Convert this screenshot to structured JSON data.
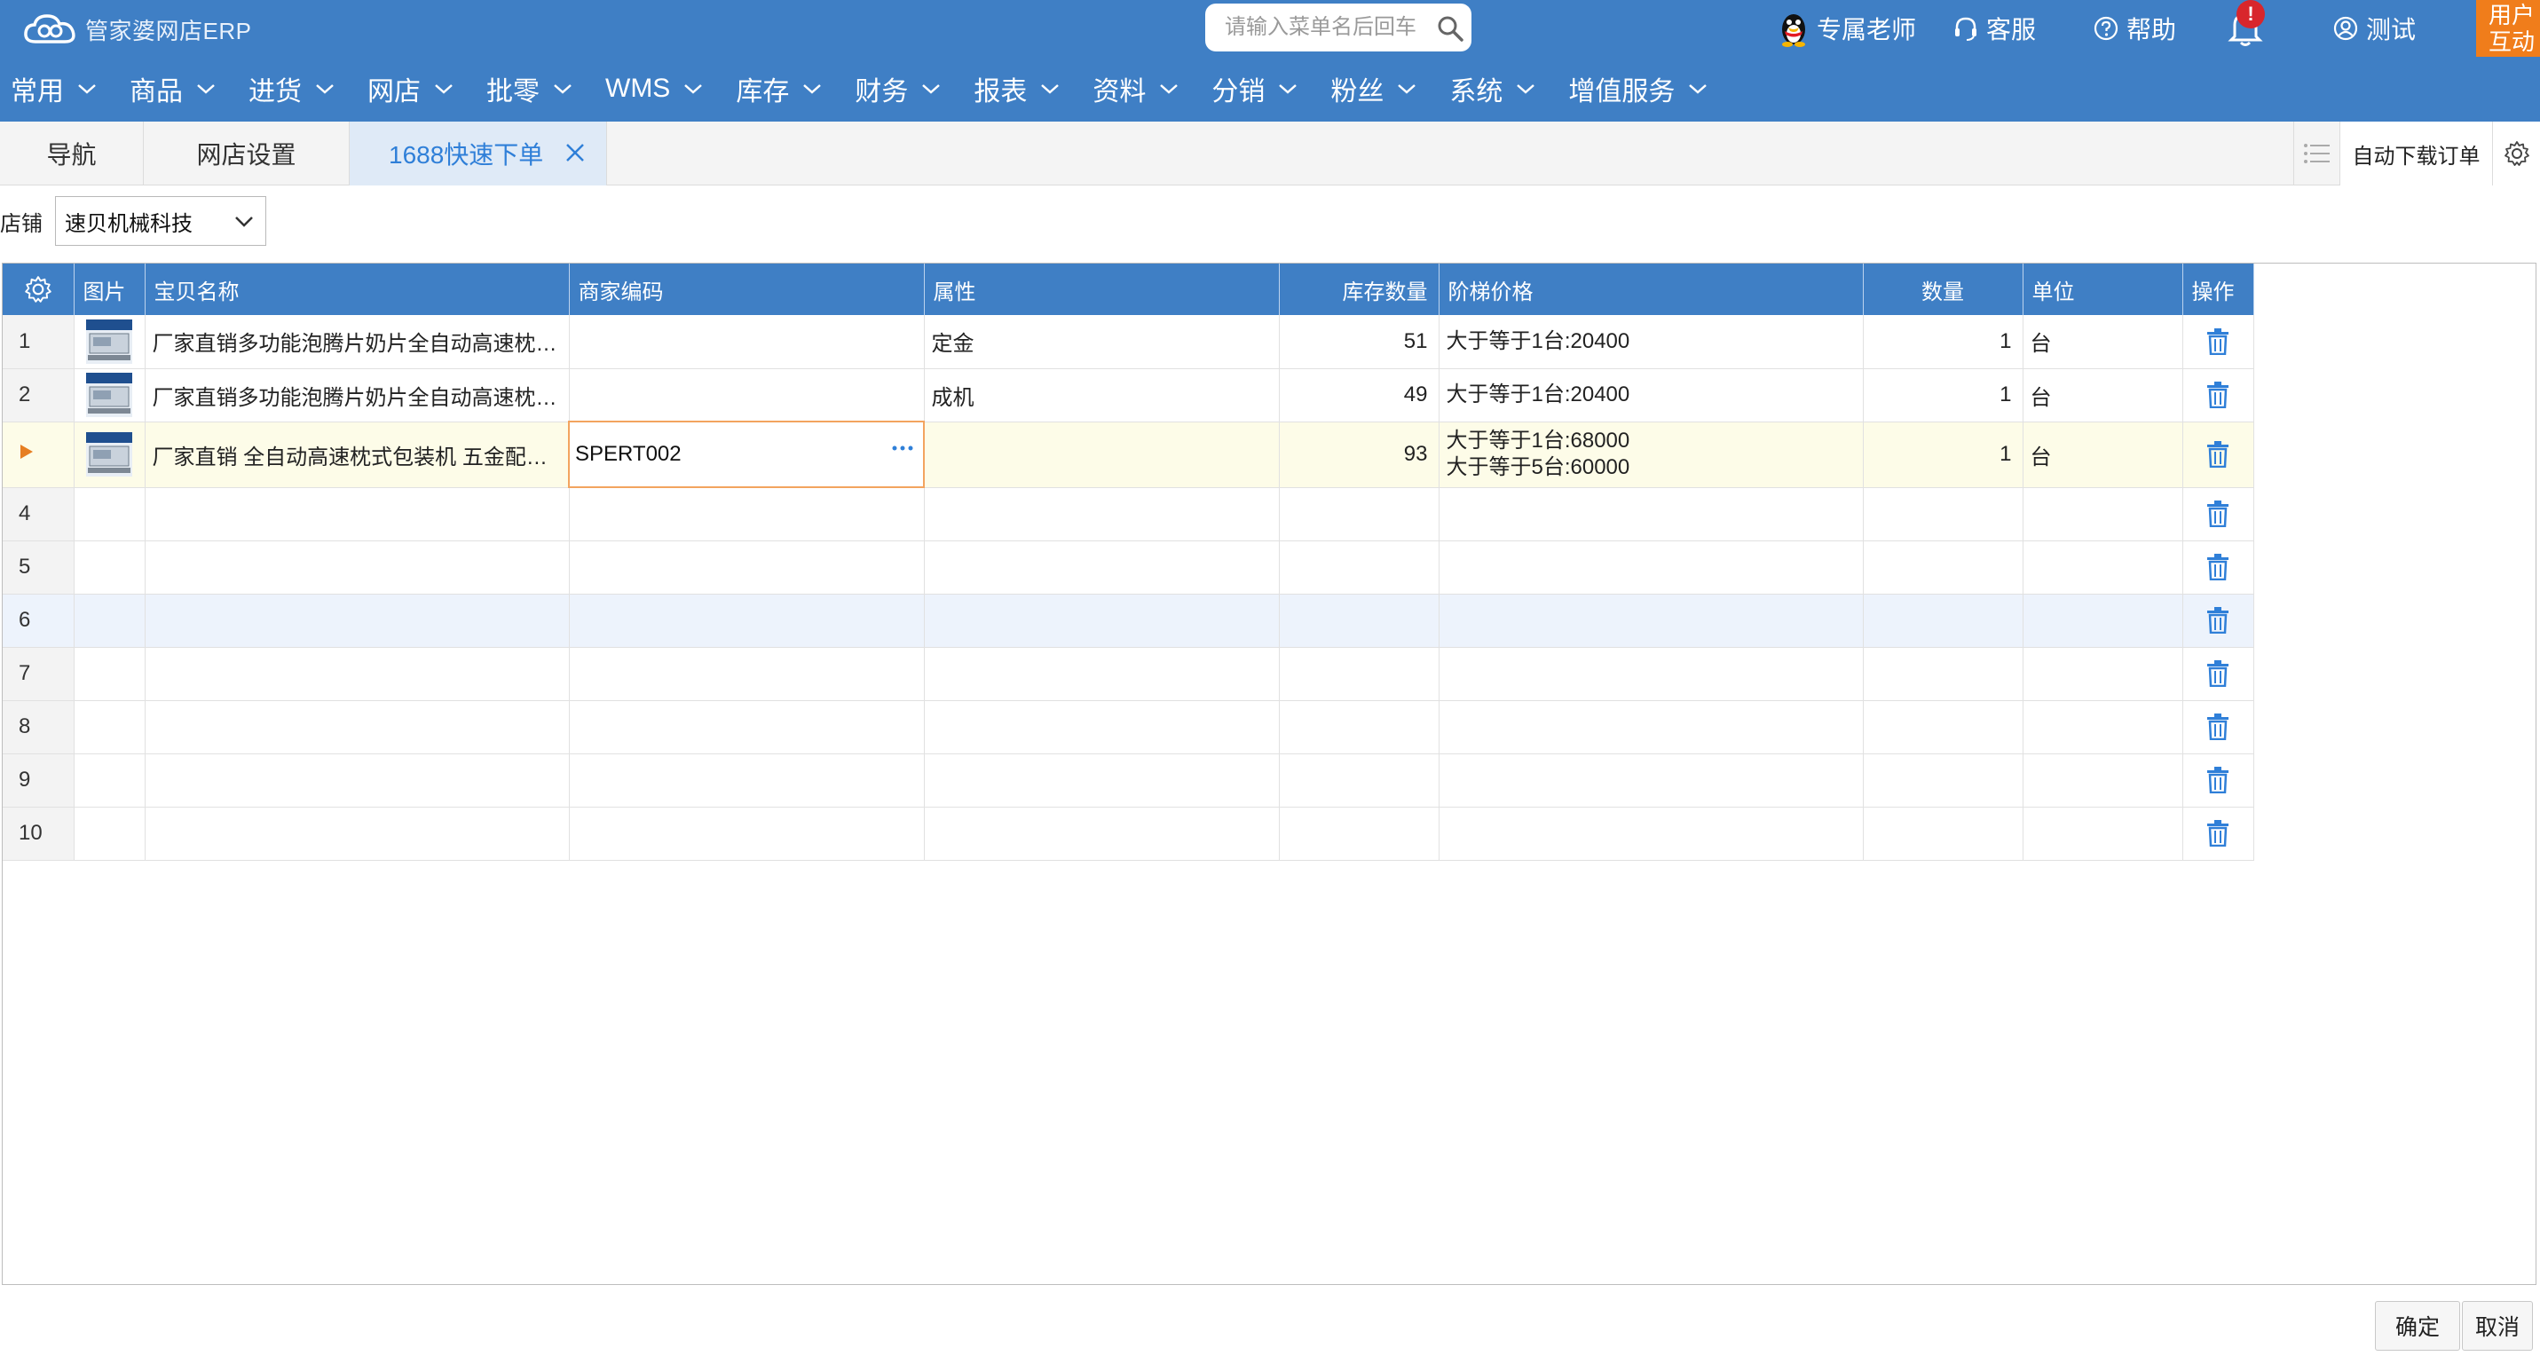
{
  "header": {
    "logo_text": "管家婆网店ERP",
    "search_placeholder": "请输入菜单名后回车",
    "teacher_label": "专属老师",
    "service_label": "客服",
    "help_label": "帮助",
    "notification_badge": "!",
    "user_label": "测试",
    "corner_line1": "用户",
    "corner_line2": "互动"
  },
  "menu": [
    {
      "label": "常用"
    },
    {
      "label": "商品"
    },
    {
      "label": "进货"
    },
    {
      "label": "网店"
    },
    {
      "label": "批零"
    },
    {
      "label": "WMS"
    },
    {
      "label": "库存"
    },
    {
      "label": "财务"
    },
    {
      "label": "报表"
    },
    {
      "label": "资料"
    },
    {
      "label": "分销"
    },
    {
      "label": "粉丝"
    },
    {
      "label": "系统"
    },
    {
      "label": "增值服务"
    }
  ],
  "tabs": [
    {
      "label": "导航"
    },
    {
      "label": "网店设置"
    },
    {
      "label": "1688快速下单",
      "active": true
    }
  ],
  "toolbar": {
    "auto_download_label": "自动下载订单"
  },
  "shop": {
    "label": "店铺",
    "value": "速贝机械科技"
  },
  "grid": {
    "columns": {
      "pic": "图片",
      "name": "宝贝名称",
      "code": "商家编码",
      "attr": "属性",
      "stock": "库存数量",
      "price": "阶梯价格",
      "qty": "数量",
      "unit": "单位",
      "op": "操作"
    },
    "rows": [
      {
        "no": "1",
        "name": "厂家直销多功能泡腾片奶片全自动高速枕式包装机",
        "code": "",
        "attr": "定金",
        "stock": "51",
        "price1": "大于等于1台:20400",
        "price2": "",
        "qty": "1",
        "unit": "台"
      },
      {
        "no": "2",
        "name": "厂家直销多功能泡腾片奶片全自动高速枕式包装机",
        "code": "",
        "attr": "成机",
        "stock": "49",
        "price1": "大于等于1台:20400",
        "price2": "",
        "qty": "1",
        "unit": "台"
      },
      {
        "no": "",
        "name": "厂家直销 全自动高速枕式包装机 五金配件包装机",
        "code": "SPERT002",
        "attr": "",
        "stock": "93",
        "price1": "大于等于1台:68000",
        "price2": "大于等于5台:60000",
        "qty": "1",
        "unit": "台"
      },
      {
        "no": "4"
      },
      {
        "no": "5"
      },
      {
        "no": "6"
      },
      {
        "no": "7"
      },
      {
        "no": "8"
      },
      {
        "no": "9"
      },
      {
        "no": "10"
      }
    ]
  },
  "footer": {
    "confirm_label": "确定",
    "cancel_label": "取消"
  },
  "colors": {
    "primary": "#3f7fc5",
    "accent_orange": "#f07d1b",
    "trash_blue": "#2f7fd8",
    "badge_red": "#d8262c"
  }
}
